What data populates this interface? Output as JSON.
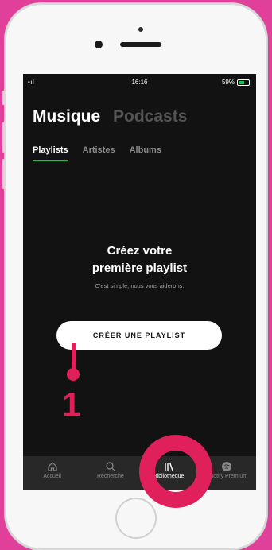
{
  "status_bar": {
    "signal": "•ıl",
    "time": "16:16",
    "battery": "59%",
    "battery_level": 0.59
  },
  "header_tabs": [
    {
      "label": "Musique",
      "active": true
    },
    {
      "label": "Podcasts",
      "active": false
    }
  ],
  "sub_tabs": [
    {
      "label": "Playlists",
      "active": true
    },
    {
      "label": "Artistes",
      "active": false
    },
    {
      "label": "Albums",
      "active": false
    }
  ],
  "empty_state": {
    "title_line1": "Créez votre",
    "title_line2": "première playlist",
    "subtitle": "C'est simple, nous vous aiderons."
  },
  "create_button": "CRÉER UNE PLAYLIST",
  "tabbar": [
    {
      "label": "Accueil",
      "icon": "home-icon"
    },
    {
      "label": "Recherche",
      "icon": "search-icon"
    },
    {
      "label": "Bibliothèque",
      "icon": "library-icon",
      "active": true
    },
    {
      "label": "Spotify Premium",
      "icon": "spotify-icon"
    }
  ],
  "annotation": {
    "step_number": "1",
    "color": "#e0205a"
  },
  "colors": {
    "accent": "#1db954",
    "background": "#121212",
    "frame": "#e0409a"
  }
}
